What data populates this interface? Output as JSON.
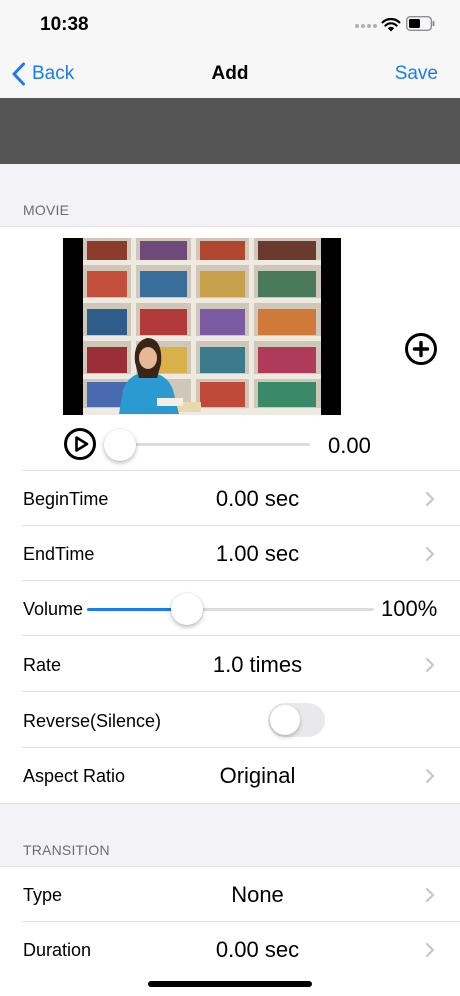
{
  "status_bar": {
    "time": "10:38"
  },
  "nav": {
    "back_label": "Back",
    "title": "Add",
    "save_label": "Save"
  },
  "movie_section": {
    "header": "MOVIE",
    "playback_position": 0.0,
    "playback_time": "0.00",
    "rows": [
      {
        "label": "BeginTime",
        "value": "0.00 sec"
      },
      {
        "label": "EndTime",
        "value": "1.00 sec"
      },
      {
        "label": "Volume",
        "value": "100%",
        "level": 0.35
      },
      {
        "label": "Rate",
        "value": "1.0 times"
      },
      {
        "label": "Reverse(Silence)",
        "toggle_on": false
      },
      {
        "label": "Aspect Ratio",
        "value": "Original"
      }
    ]
  },
  "transition_section": {
    "header": "TRANSITION",
    "rows": [
      {
        "label": "Type",
        "value": "None"
      },
      {
        "label": "Duration",
        "value": "0.00 sec"
      }
    ]
  },
  "colors": {
    "accent": "#1a7cf5",
    "banner": "#555555",
    "background": "#f2f2f7"
  }
}
